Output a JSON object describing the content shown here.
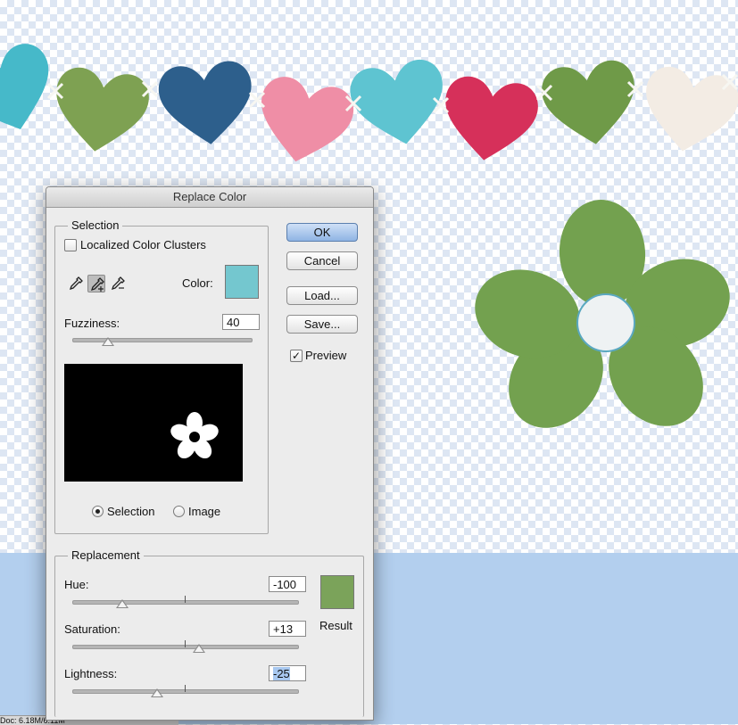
{
  "dialog": {
    "title": "Replace Color",
    "ok_label": "OK",
    "cancel_label": "Cancel",
    "load_label": "Load...",
    "save_label": "Save...",
    "preview_label": "Preview",
    "preview_checked": true
  },
  "selection": {
    "legend": "Selection",
    "localized_label": "Localized Color Clusters",
    "localized_checked": false,
    "color_label": "Color:",
    "color_value": "#74c7cf",
    "fuzziness_label": "Fuzziness:",
    "fuzziness_value": "40",
    "fuzziness_fraction": 0.2,
    "view_selection_label": "Selection",
    "view_image_label": "Image",
    "view_mode": "selection",
    "tools": [
      "eyedropper-icon",
      "eyedropper-plus-icon",
      "eyedropper-minus-icon"
    ]
  },
  "replacement": {
    "legend": "Replacement",
    "hue_label": "Hue:",
    "hue_value": "-100",
    "hue_number": -100,
    "saturation_label": "Saturation:",
    "saturation_value": "+13",
    "saturation_number": 13,
    "lightness_label": "Lightness:",
    "lightness_value": "-25",
    "lightness_number": -25,
    "result_label": "Result",
    "result_color": "#7ba35a"
  },
  "colors": {
    "heart_colors": [
      "#46b9c9",
      "#7ea152",
      "#2d5f8c",
      "#ef8ea6",
      "#5ec4d1",
      "#d6305a",
      "#6f9a48",
      "#f3ece4"
    ],
    "flower_green": "#73a14f",
    "flower_center": "#eef2f3",
    "canvas_blue": "#b3cfee"
  },
  "status": {
    "doc_text": "Doc: 6.18M/6.11M"
  }
}
